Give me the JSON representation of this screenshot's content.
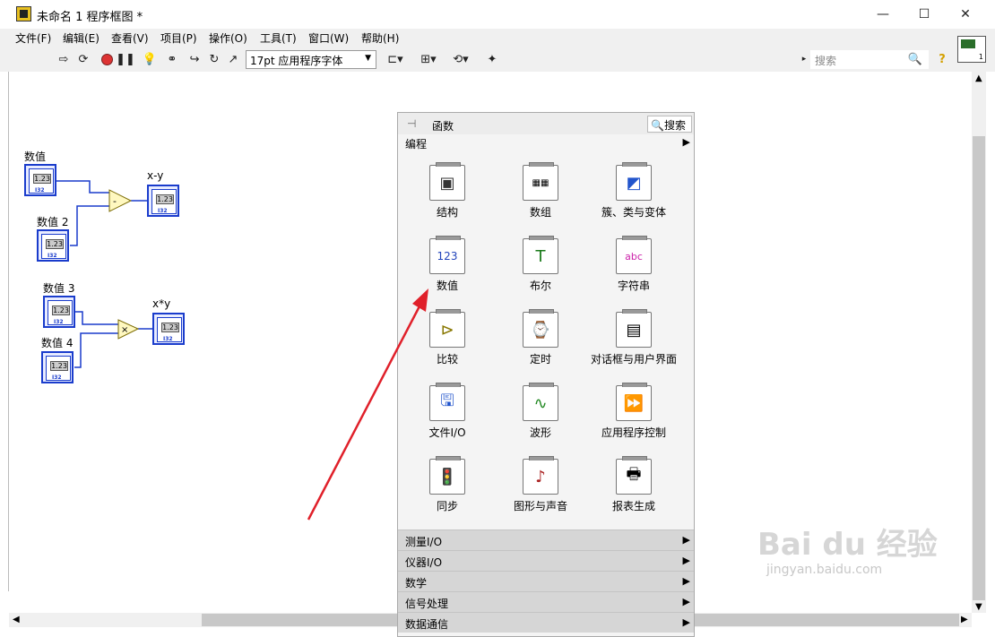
{
  "window": {
    "title": "未命名 1 程序框图 *",
    "minimize": "—",
    "maximize": "☐",
    "close": "✕"
  },
  "menu": [
    "文件(F)",
    "编辑(E)",
    "查看(V)",
    "项目(P)",
    "操作(O)",
    "工具(T)",
    "窗口(W)",
    "帮助(H)"
  ],
  "toolbar": {
    "icons": [
      "run-arrow-icon",
      "run-continuous-icon",
      "abort-icon",
      "pause-icon",
      "highlight-bulb-icon",
      "retain-wire-icon",
      "step-into-icon",
      "step-over-icon",
      "step-out-icon",
      "align-icon",
      "distribute-icon",
      "reorder-icon",
      "cleanup-icon"
    ],
    "font_select": "17pt 应用程序字体",
    "search_placeholder": "搜索",
    "connector_number": "1"
  },
  "diagram": {
    "controls": [
      {
        "label": "数值",
        "value": "1.23"
      },
      {
        "label": "数值 2",
        "value": "1.23"
      },
      {
        "label": "数值 3",
        "value": "1.23"
      },
      {
        "label": "数值 4",
        "value": "1.23"
      }
    ],
    "indicators": [
      {
        "label": "x-y",
        "value": "1.23"
      },
      {
        "label": "x*y",
        "value": "1.23"
      }
    ],
    "ops": [
      "-",
      "×"
    ],
    "tag": "I32"
  },
  "palette": {
    "title": "函数",
    "search": "搜索",
    "category": "编程",
    "items": [
      {
        "label": "结构",
        "icon": "structures-icon"
      },
      {
        "label": "数组",
        "icon": "array-icon"
      },
      {
        "label": "簇、类与变体",
        "icon": "cluster-icon"
      },
      {
        "label": "数值",
        "icon": "numeric-icon"
      },
      {
        "label": "布尔",
        "icon": "boolean-icon"
      },
      {
        "label": "字符串",
        "icon": "string-icon"
      },
      {
        "label": "比较",
        "icon": "comparison-icon"
      },
      {
        "label": "定时",
        "icon": "timing-icon"
      },
      {
        "label": "对话框与用户界面",
        "icon": "dialog-icon"
      },
      {
        "label": "文件I/O",
        "icon": "file-io-icon"
      },
      {
        "label": "波形",
        "icon": "waveform-icon"
      },
      {
        "label": "应用程序控制",
        "icon": "app-control-icon"
      },
      {
        "label": "同步",
        "icon": "sync-icon"
      },
      {
        "label": "图形与声音",
        "icon": "graphics-sound-icon"
      },
      {
        "label": "报表生成",
        "icon": "report-icon"
      }
    ],
    "subcategories": [
      "测量I/O",
      "仪器I/O",
      "数学",
      "信号处理",
      "数据通信"
    ]
  },
  "watermark": {
    "text": "Bai du 经验",
    "sub": "jingyan.baidu.com"
  },
  "colors": {
    "wire": "#1a3ccc",
    "arrow": "#e0202a"
  }
}
